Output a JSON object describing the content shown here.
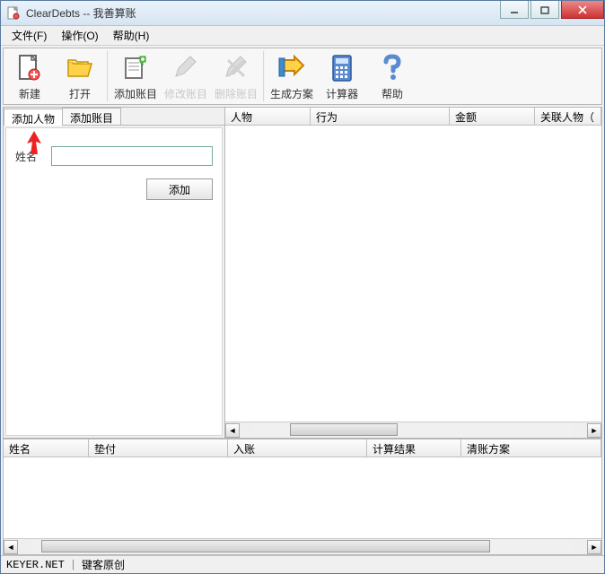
{
  "window": {
    "title": "ClearDebts -- 我善算账"
  },
  "menus": {
    "file": "文件(F)",
    "operate": "操作(O)",
    "help": "帮助(H)"
  },
  "toolbar": {
    "new": "新建",
    "open": "打开",
    "add_account": "添加账目",
    "edit_account": "修改账目",
    "delete_account": "删除账目",
    "gen_plan": "生成方案",
    "calculator": "计算器",
    "help": "帮助"
  },
  "left_panel": {
    "tabs": {
      "add_person": "添加人物",
      "add_account": "添加账目"
    },
    "form": {
      "name_label": "姓名",
      "name_value": "",
      "add_btn": "添加"
    }
  },
  "upper_table": {
    "columns": {
      "person": "人物",
      "action": "行为",
      "amount": "金额",
      "related": "关联人物（"
    },
    "widths": [
      "95px",
      "155px",
      "95px",
      "70px"
    ]
  },
  "lower_table": {
    "columns": {
      "name": "姓名",
      "advance": "垫付",
      "income": "入账",
      "calc": "计算结果",
      "plan": "清账方案"
    },
    "widths": [
      "95px",
      "155px",
      "155px",
      "105px",
      "150px"
    ]
  },
  "status": {
    "left": "KEYER.NET",
    "right": "键客原创"
  }
}
